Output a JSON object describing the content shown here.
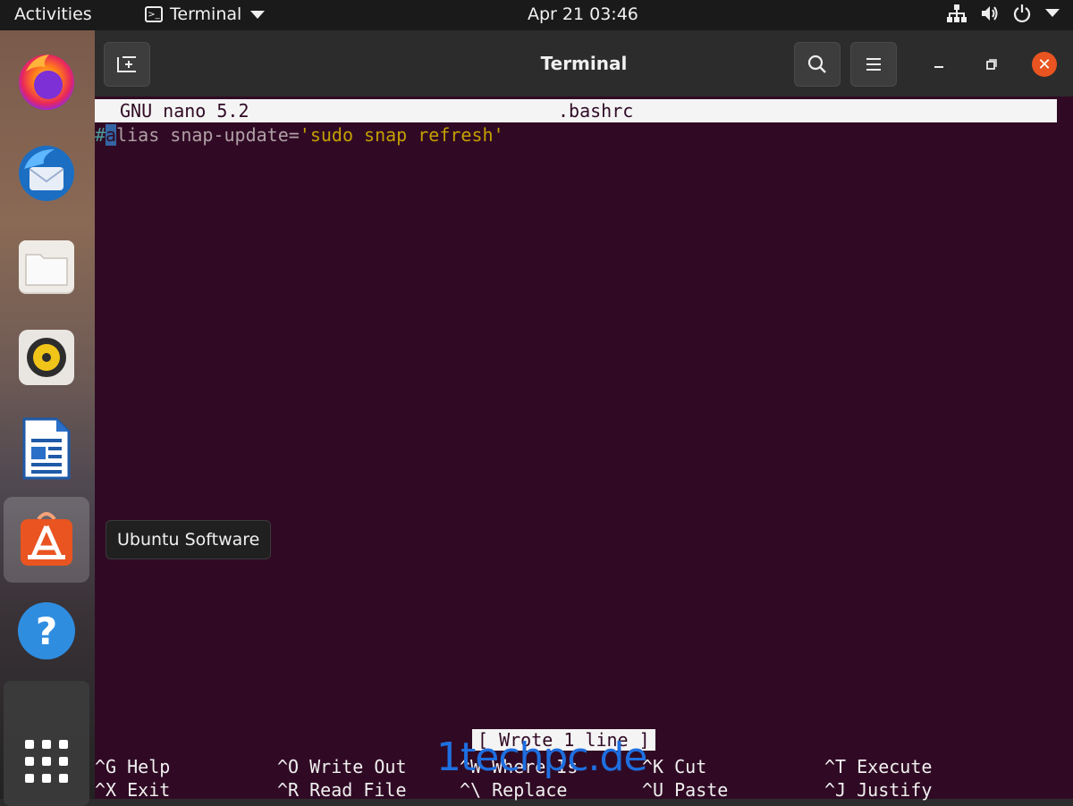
{
  "topbar": {
    "activities": "Activities",
    "app_menu": "Terminal",
    "clock": "Apr 21  03:46"
  },
  "dock": {
    "items": [
      "firefox",
      "thunderbird",
      "files",
      "rhythmbox",
      "libreoffice-writer",
      "ubuntu-software",
      "help",
      "show-apps"
    ],
    "tooltip": "Ubuntu Software"
  },
  "window": {
    "title": "Terminal",
    "new_tab_glyph": "⊞",
    "close_glyph": "✕"
  },
  "nano": {
    "version": "GNU nano 5.2",
    "filename": ".bashrc",
    "line_hash": "#",
    "line_cursor": "a",
    "line_rest": "lias snap-update=",
    "line_string": "'sudo snap refresh'",
    "status": "[ Wrote 1 line ]",
    "shortcuts_row1": [
      {
        "key": "^G",
        "label": "Help"
      },
      {
        "key": "^O",
        "label": "Write Out"
      },
      {
        "key": "^W",
        "label": "Where Is"
      },
      {
        "key": "^K",
        "label": "Cut"
      },
      {
        "key": "^T",
        "label": "Execute"
      }
    ],
    "shortcuts_row2": [
      {
        "key": "^X",
        "label": "Exit"
      },
      {
        "key": "^R",
        "label": "Read File"
      },
      {
        "key": "^\\",
        "label": "Replace"
      },
      {
        "key": "^U",
        "label": "Paste"
      },
      {
        "key": "^J",
        "label": "Justify"
      }
    ]
  },
  "watermark": "1techpc.de",
  "colors": {
    "terminal_bg": "#300a24",
    "accent": "#e95420",
    "comment_hash": "#4e9a9a",
    "string": "#c4a000"
  }
}
